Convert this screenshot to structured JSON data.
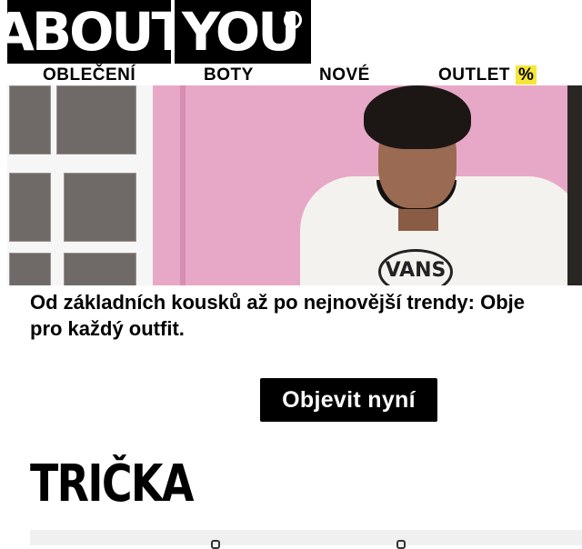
{
  "brand": {
    "part1": "ABOUT",
    "part2": "YOU"
  },
  "nav": {
    "items": [
      {
        "label": "OBLEČENÍ"
      },
      {
        "label": "BOTY"
      },
      {
        "label": "NOVÉ"
      },
      {
        "label": "OUTLET",
        "badge": "%"
      }
    ]
  },
  "hero": {
    "shirt_print": "VANS"
  },
  "intro": {
    "text": "Od základních kousků až po nejnovější trendy: Obje\npro každý outfit."
  },
  "cta": {
    "label": "Objevit nyní"
  },
  "section": {
    "title": "TRIČKA"
  },
  "icons": [
    "heart-icon",
    "heart-icon"
  ],
  "colors": {
    "accent": "#f5e63a",
    "primary": "#000000",
    "hero_bg": "#e7a8c7"
  }
}
